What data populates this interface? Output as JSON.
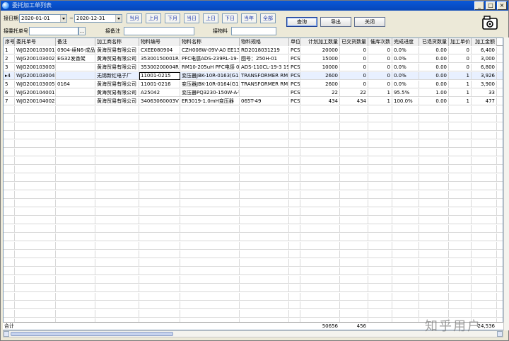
{
  "window": {
    "title": "委托加工单列表",
    "min": "_",
    "max": "□",
    "close": "×"
  },
  "filters": {
    "date_label": "接日期",
    "date_from": "2020-01-01",
    "date_sep": "~",
    "date_to": "2020-12-31",
    "client_no_label": "接委托单号",
    "client_no": "",
    "remark_label": "接备注",
    "remark": "",
    "material_label": "接物料",
    "material": ""
  },
  "quick_dates": [
    "当月",
    "上月",
    "下月",
    "当日",
    "上日",
    "下日",
    "当年",
    "全部"
  ],
  "actions": {
    "query": "查询",
    "export": "导出",
    "close": "关闭"
  },
  "table": {
    "columns": [
      "序号",
      "委托单号",
      "备注",
      "加工商名称",
      "物料编号",
      "物料名称",
      "物料规格",
      "单位",
      "计划加工数量",
      "已交货数量",
      "催库次数",
      "完成进度",
      "已退货数量",
      "加工单价",
      "加工金额"
    ],
    "rows": [
      [
        "1",
        "WJG200103001",
        "0904-续N6-成品",
        "黄海贸易有限公司",
        "CXEE080904",
        "CZH008W-09V-A0 EE13加-",
        "RD2018031219",
        "PCS",
        "20000",
        "0",
        "0",
        "0.0%",
        "0.00",
        "0",
        "6,400"
      ],
      [
        "2",
        "WJG200103002",
        "EG32发香架",
        "黄海贸易有限公司",
        "35300150001R",
        "PFC电感ADS-239RL-19-1",
        "图号：250H-01",
        "PCS",
        "15000",
        "0",
        "0",
        "0.0%",
        "0.00",
        "0",
        "3,000"
      ],
      [
        "3",
        "WJG200103003",
        "",
        "黄海贸易有限公司",
        "35300200004R",
        "RM10-205uH PFC电感 090",
        "ADS-110CL-19-3 1901",
        "PCS",
        "10000",
        "0",
        "0",
        "0.0%",
        "0.00",
        "0",
        "6,800"
      ],
      [
        "4",
        "WJG200103004",
        "",
        "无锡新红电子厂",
        "11001-0215",
        "变压器JBK-10R-0163(G11",
        "TRANSFORMER RM10",
        "PCS",
        "2600",
        "0",
        "0",
        "0.0%",
        "0.00",
        "1",
        "3,926"
      ],
      [
        "5",
        "WJG200103005",
        "0164",
        "黄海贸易有限公司",
        "11001-0216",
        "变压器JBK-10R-0164(G11",
        "TRANSFORMER RM10",
        "PCS",
        "2600",
        "0",
        "0",
        "0.0%",
        "0.00",
        "1",
        "3,900"
      ],
      [
        "6",
        "WJG200104001",
        "",
        "黄海贸易有限公司",
        "A25042",
        "变压器PQ3230-150W-A-V1",
        "",
        "PCS",
        "22",
        "22",
        "1",
        "95.5%",
        "1.00",
        "1",
        "33"
      ],
      [
        "7",
        "WJG200104002",
        "",
        "黄海贸易有限公司",
        "34063060003V",
        "ER3019-1.0mH变压器",
        "065T-49",
        "PCS",
        "434",
        "434",
        "1",
        "100.0%",
        "0.00",
        "1",
        "477"
      ]
    ],
    "totals": {
      "label": "合计",
      "planned": "50656",
      "delivered": "456",
      "amount": "24,536"
    }
  },
  "watermark": "知乎用户"
}
